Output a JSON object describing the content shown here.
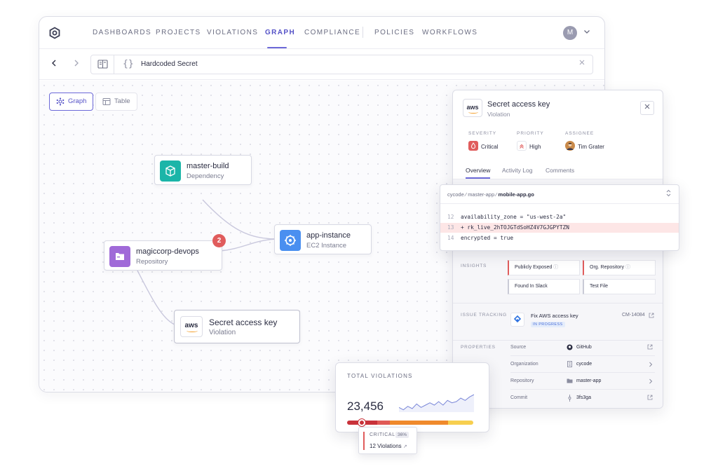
{
  "nav": {
    "items": [
      "DASHBOARDS",
      "PROJECTS",
      "VIOLATIONS",
      "GRAPH",
      "COMPLIANCE",
      "POLICIES",
      "WORKFLOWS"
    ],
    "active": "GRAPH",
    "avatar_initial": "M"
  },
  "pathbar": {
    "query": "Hardcoded Secret"
  },
  "view_toggle": {
    "graph_label": "Graph",
    "table_label": "Table",
    "active": "Graph"
  },
  "graph": {
    "nodes": [
      {
        "id": "master-build",
        "title": "master-build",
        "subtitle": "Dependency",
        "icon": "package-icon",
        "color": "#1bb5a8"
      },
      {
        "id": "app-instance",
        "title": "app-instance",
        "subtitle": "EC2 Instance",
        "icon": "chip-icon",
        "color": "#4a8ff0"
      },
      {
        "id": "magiccorp-devops",
        "title": "magiccorp-devops",
        "subtitle": "Repository",
        "icon": "folder-icon",
        "color": "#a06ad8",
        "badge": "2"
      },
      {
        "id": "secret-access-key",
        "title": "Secret access key",
        "subtitle": "Violation",
        "icon": "aws-logo"
      }
    ],
    "badge_color": "#e05c5c"
  },
  "panel": {
    "logo_text": "aws",
    "title": "Secret access key",
    "subtitle": "Violation",
    "severity": {
      "label": "SEVERITY",
      "value": "Critical",
      "color": "#e05c5c"
    },
    "priority": {
      "label": "PRIORITY",
      "value": "High"
    },
    "assignee": {
      "label": "ASSIGNEE",
      "value": "Tim Grater"
    },
    "tabs": [
      "Overview",
      "Activity Log",
      "Comments"
    ],
    "active_tab": "Overview",
    "insights": {
      "label": "INSIGHTS",
      "items": [
        "Publicly Exposed",
        "Org. Repository",
        "Found In Slack",
        "Test File"
      ]
    },
    "issue_tracking": {
      "label": "ISSUE TRACKING",
      "title": "Fix AWS access key",
      "status": "IN PROGRESS",
      "ticket": "CM-14084"
    },
    "properties": {
      "label": "PROPERTIES",
      "rows": [
        {
          "label": "Source",
          "value": "GitHub",
          "icon": "github-icon",
          "end": "external-link-icon"
        },
        {
          "label": "Organization",
          "value": "cycode",
          "icon": "building-icon",
          "end": "chevron-right-icon"
        },
        {
          "label": "Repository",
          "value": "master-app",
          "icon": "folder-icon",
          "end": "chevron-right-icon"
        },
        {
          "label": "Commit",
          "value": "3fs3ga",
          "icon": "commit-icon",
          "end": "external-link-icon"
        }
      ]
    }
  },
  "code": {
    "path_org": "cycode",
    "path_repo": "master-app",
    "path_file": "mobile-app.go",
    "lines": [
      {
        "num": "12",
        "text": "availability_zone = \"us-west-2a\"",
        "highlight": false
      },
      {
        "num": "13",
        "text": "+ rk_live_2hTOJGTdSoHZ4V7GJGPYTZN",
        "highlight": true
      },
      {
        "num": "14",
        "text": "encrypted = true",
        "highlight": false
      }
    ]
  },
  "total_violations": {
    "label": "TOTAL VIOLATIONS",
    "value": "23,456",
    "spark": [
      14,
      16,
      13,
      15,
      11,
      14,
      12,
      10,
      12,
      9,
      12,
      8,
      10,
      9,
      6,
      8,
      5,
      3
    ],
    "distribution": [
      {
        "level": "critical",
        "fraction": 0.24,
        "color": "#c9323a"
      },
      {
        "level": "high",
        "fraction": 0.1,
        "color": "#e15a57"
      },
      {
        "level": "medium",
        "fraction": 0.46,
        "color": "#f08a2c"
      },
      {
        "level": "low",
        "fraction": 0.2,
        "color": "#f7cf4f"
      }
    ],
    "tooltip": {
      "label": "CRITICAL",
      "percent": "36%",
      "count": "12 Violations"
    }
  }
}
